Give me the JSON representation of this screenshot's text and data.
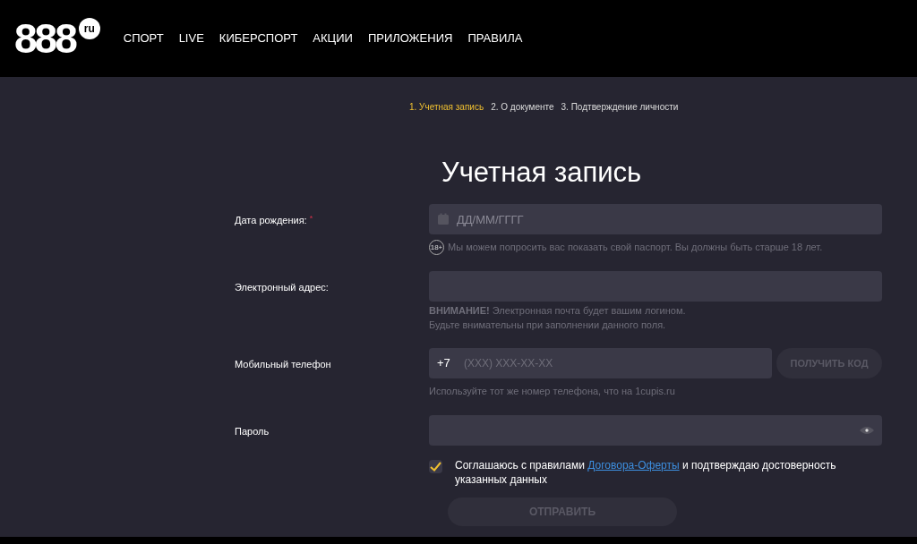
{
  "header": {
    "logo": {
      "digits": "888",
      "suffix": "ru"
    },
    "nav": [
      {
        "label": "СПОРТ"
      },
      {
        "label": "LIVE"
      },
      {
        "label": "КИБЕРСПОРТ"
      },
      {
        "label": "АКЦИИ"
      },
      {
        "label": "ПРИЛОЖЕНИЯ"
      },
      {
        "label": "ПРАВИЛА"
      }
    ]
  },
  "steps": [
    {
      "label": "1. Учетная запись",
      "selected": true
    },
    {
      "label": "2. О документе",
      "selected": false
    },
    {
      "label": "3. Подтверждение личности",
      "selected": false
    }
  ],
  "title": "Учетная запись",
  "fields": [
    {
      "kind": "date",
      "label": "Дата рождения:",
      "required_mark": "*",
      "placeholder": "ДД/ММ/ГГГГ",
      "hint": "Мы можем попросить вас показать свой паспорт. Вы должны быть старше 18 лет.",
      "hint_badge": "18+"
    },
    {
      "kind": "email",
      "label": "Электронный адрес:",
      "notes": [
        "**ВНИМАНИЕ!** Электронная почта будет вашим логином.",
        "Будьте внимательны при заполнении данного поля."
      ]
    },
    {
      "kind": "phone",
      "label": "Мобильный телефон",
      "prefix": "+7",
      "placeholder": "(XXX) XXX-XX-XX",
      "button": "ПОЛУЧИТЬ КОД",
      "hint": "Используйте тот же номер телефона, что на 1cupis.ru"
    },
    {
      "kind": "password",
      "label": "Пароль"
    }
  ],
  "agreement": {
    "checked": true,
    "before": "Соглашаюсь с правилами",
    "link": "Договора-Оферты",
    "after": "и подтверждаю достоверность указанных данных"
  },
  "submit": "ОТПРАВИТЬ"
}
